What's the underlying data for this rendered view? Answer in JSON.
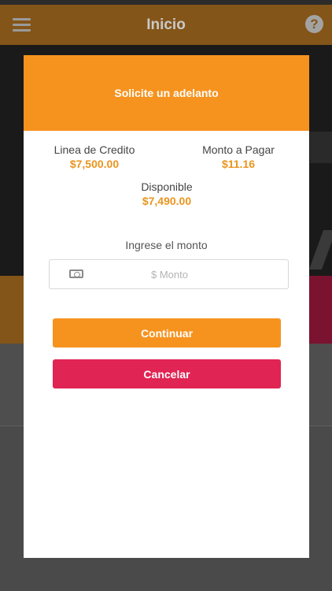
{
  "app": {
    "header_title": "Inicio",
    "menu_icon": "hamburger-menu-icon",
    "help_icon": "help-icon",
    "help_glyph": "?"
  },
  "modal": {
    "title": "Solicite un adelanto",
    "credit_line_label": "Linea de Credito",
    "credit_line_value": "$7,500.00",
    "amount_due_label": "Monto a Pagar",
    "amount_due_value": "$11.16",
    "available_label": "Disponible",
    "available_value": "$7,490.00",
    "amount_prompt": "Ingrese el monto",
    "amount_icon": "money-icon",
    "amount_placeholder": "$ Monto",
    "amount_value": "",
    "continue_label": "Continuar",
    "cancel_label": "Cancelar"
  },
  "colors": {
    "accent_orange": "#f6931f",
    "cancel_red": "#e02453",
    "value_orange": "#e9951e"
  }
}
